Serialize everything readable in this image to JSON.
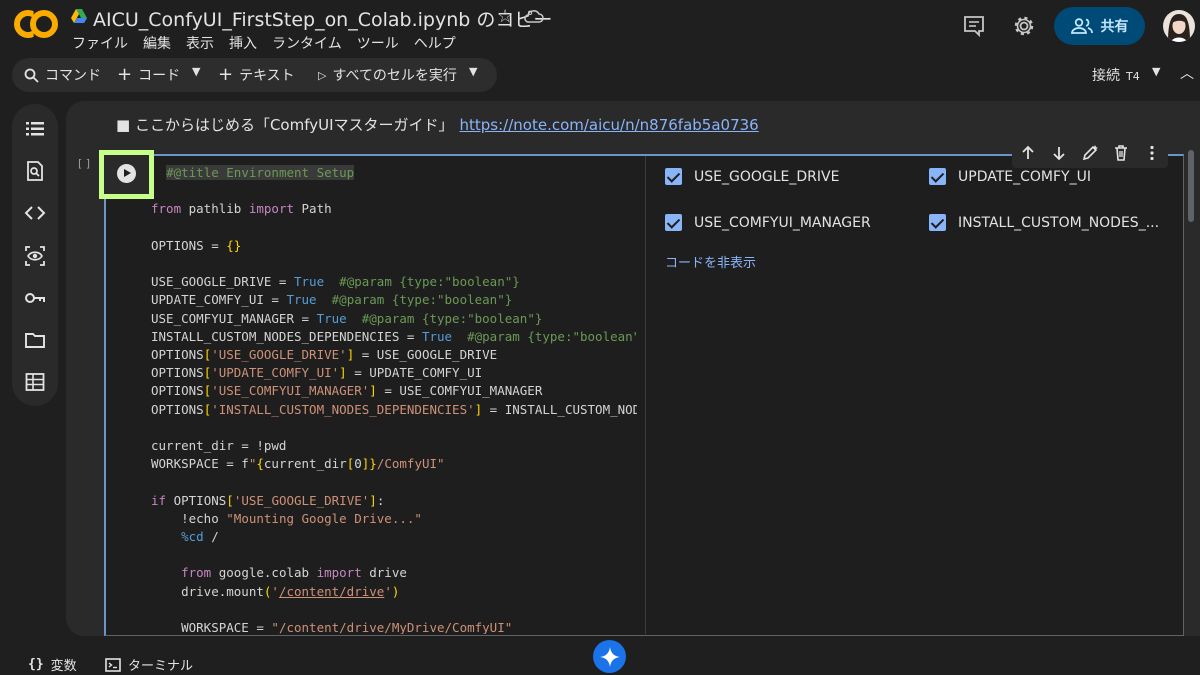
{
  "header": {
    "title": "AICU_ConfyUI_FirstStep_on_Colab.ipynb のコピー",
    "share_label": "共有",
    "menu": [
      "ファイル",
      "編集",
      "表示",
      "挿入",
      "ランタイム",
      "ツール",
      "ヘルプ"
    ]
  },
  "toolbar": {
    "command": "コマンド",
    "code": "コード",
    "text": "テキスト",
    "run_all": "すべてのセルを実行",
    "connect": "接続",
    "runtime": "T4"
  },
  "text_cell": {
    "prefix": "■ ここからはじめる「ComfyUIマスターガイド」",
    "link": "https://note.com/aicu/n/n876fab5a0736"
  },
  "code_cell": {
    "bracket": "[ ]",
    "title_comment": "#@title Environment Setup"
  },
  "form": {
    "fields": [
      {
        "label": "USE_GOOGLE_DRIVE",
        "checked": true
      },
      {
        "label": "UPDATE_COMFY_UI",
        "checked": true
      },
      {
        "label": "USE_COMFYUI_MANAGER",
        "checked": true
      },
      {
        "label": "INSTALL_CUSTOM_NODES_...",
        "checked": true
      }
    ],
    "hide_code": "コードを非表示"
  },
  "bottom": {
    "variables": "変数",
    "terminal": "ターミナル"
  },
  "colors": {
    "accent": "#8ab4f8",
    "share_bg": "#004a77",
    "highlight": "#c6ff8a",
    "logo": "#f9ab00"
  }
}
